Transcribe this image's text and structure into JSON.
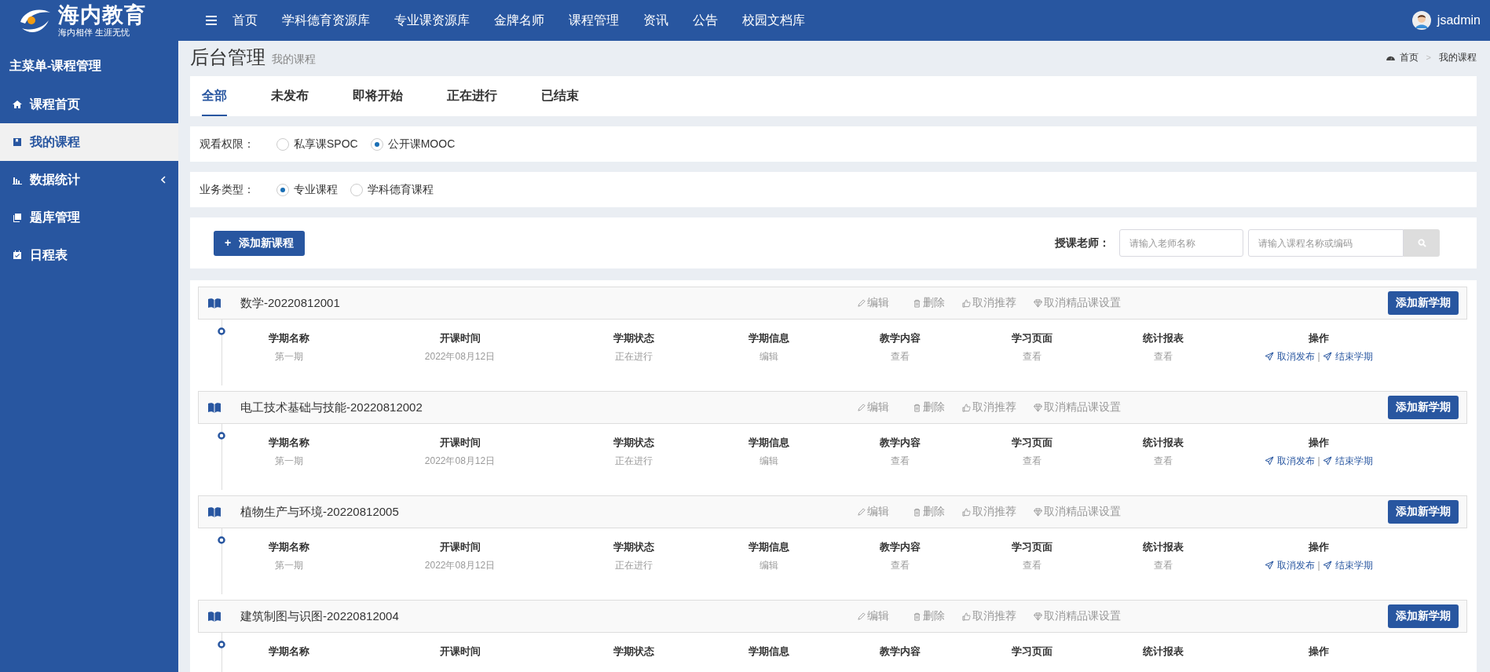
{
  "brand": {
    "name": "海内教育",
    "slogan": "海内相伴 生涯无忧"
  },
  "nav": [
    "首页",
    "学科德育资源库",
    "专业课资源库",
    "金牌名师",
    "课程管理",
    "资讯",
    "公告",
    "校园文档库"
  ],
  "user": {
    "name": "jsadmin"
  },
  "sidebar": {
    "title": "主菜单-课程管理",
    "items": [
      {
        "label": "课程首页",
        "kind": "link",
        "selected": false
      },
      {
        "label": "我的课程",
        "kind": "link",
        "selected": true
      },
      {
        "label": "数据统计",
        "kind": "group",
        "selected": false
      },
      {
        "label": "题库管理",
        "kind": "link",
        "selected": false
      },
      {
        "label": "日程表",
        "kind": "link",
        "selected": false
      }
    ]
  },
  "page": {
    "title": "后台管理",
    "subtitle": "我的课程"
  },
  "breadcrumb": {
    "items": [
      "首页",
      "我的课程"
    ],
    "separator": ">"
  },
  "tabs": [
    {
      "label": "全部",
      "selected": true
    },
    {
      "label": "未发布",
      "selected": false
    },
    {
      "label": "即将开始",
      "selected": false
    },
    {
      "label": "正在进行",
      "selected": false
    },
    {
      "label": "已结束",
      "selected": false
    }
  ],
  "filters": [
    {
      "label": "观看权限：",
      "options": [
        {
          "label": "私享课SPOC",
          "selected": false
        },
        {
          "label": "公开课MOOC",
          "selected": true
        }
      ]
    },
    {
      "label": "业务类型：",
      "options": [
        {
          "label": "专业课程",
          "selected": true
        },
        {
          "label": "学科德育课程",
          "selected": false
        }
      ]
    }
  ],
  "toolbar": {
    "add_button": {
      "icon": "+",
      "label": "添加新课程"
    },
    "teacher_label": "授课老师：",
    "teacher_field": {
      "placeholder": "请输入老师名称"
    },
    "search_field": {
      "placeholder": "请输入课程名称或编码"
    }
  },
  "courses": [
    {
      "title": "数学-20220812001",
      "actions": [
        "编辑",
        "删除",
        "取消推荐",
        "取消精品课设置"
      ],
      "add_button": "添加新学期",
      "columns": [
        "学期名称",
        "开课时间",
        "学期状态",
        "学期信息",
        "教学内容",
        "学习页面",
        "统计报表",
        "操作"
      ],
      "semesters": [
        {
          "cells": [
            "第一期",
            "2022年08月12日",
            "正在进行",
            "编辑",
            "查看",
            "查看",
            "查看"
          ],
          "operations": [
            "取消发布",
            "结束学期"
          ],
          "separator": "|"
        }
      ]
    },
    {
      "title": "电工技术基础与技能-20220812002",
      "actions": [
        "编辑",
        "删除",
        "取消推荐",
        "取消精品课设置"
      ],
      "add_button": "添加新学期",
      "columns": [
        "学期名称",
        "开课时间",
        "学期状态",
        "学期信息",
        "教学内容",
        "学习页面",
        "统计报表",
        "操作"
      ],
      "semesters": [
        {
          "cells": [
            "第一期",
            "2022年08月12日",
            "正在进行",
            "编辑",
            "查看",
            "查看",
            "查看"
          ],
          "operations": [
            "取消发布",
            "结束学期"
          ],
          "separator": "|"
        }
      ]
    },
    {
      "title": "植物生产与环境-20220812005",
      "actions": [
        "编辑",
        "删除",
        "取消推荐",
        "取消精品课设置"
      ],
      "add_button": "添加新学期",
      "columns": [
        "学期名称",
        "开课时间",
        "学期状态",
        "学期信息",
        "教学内容",
        "学习页面",
        "统计报表",
        "操作"
      ],
      "semesters": [
        {
          "cells": [
            "第一期",
            "2022年08月12日",
            "正在进行",
            "编辑",
            "查看",
            "查看",
            "查看"
          ],
          "operations": [
            "取消发布",
            "结束学期"
          ],
          "separator": "|"
        }
      ]
    },
    {
      "title": "建筑制图与识图-20220812004",
      "actions": [
        "编辑",
        "删除",
        "取消推荐",
        "取消精品课设置"
      ],
      "add_button": "添加新学期",
      "columns": [
        "学期名称",
        "开课时间",
        "学期状态",
        "学期信息",
        "教学内容",
        "学习页面",
        "统计报表",
        "操作"
      ]
    }
  ]
}
